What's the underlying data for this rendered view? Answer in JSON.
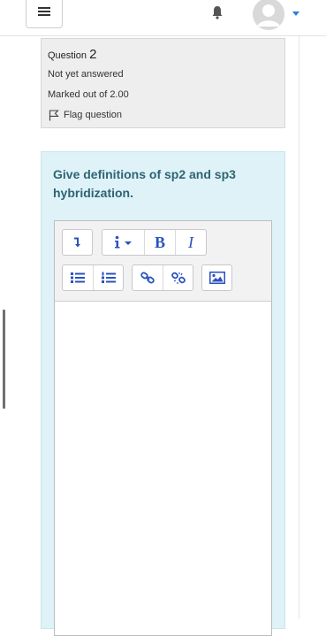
{
  "header": {
    "menu_icon": "hamburger-icon",
    "notification_icon": "bell-icon",
    "user_icon": "avatar-icon",
    "user_menu_icon": "caret-down-icon"
  },
  "question_info": {
    "label": "Question",
    "number": "2",
    "status": "Not yet answered",
    "marks": "Marked out of 2.00",
    "flag_label": "Flag question"
  },
  "question": {
    "text": "Give definitions of sp2 and sp3 hybridization."
  },
  "editor_toolbar": {
    "row1": [
      "show-more-buttons-icon",
      "info-dropdown-icon",
      "bold-icon",
      "italic-icon"
    ],
    "row2": [
      "unordered-list-icon",
      "ordered-list-icon",
      "link-icon",
      "unlink-icon",
      "image-icon"
    ],
    "bold_glyph": "B",
    "italic_glyph": "I"
  },
  "colors": {
    "accent": "#2a52be",
    "question_text": "#2f6473",
    "content_bg": "#def2f8",
    "info_bg": "#eeeeee"
  }
}
